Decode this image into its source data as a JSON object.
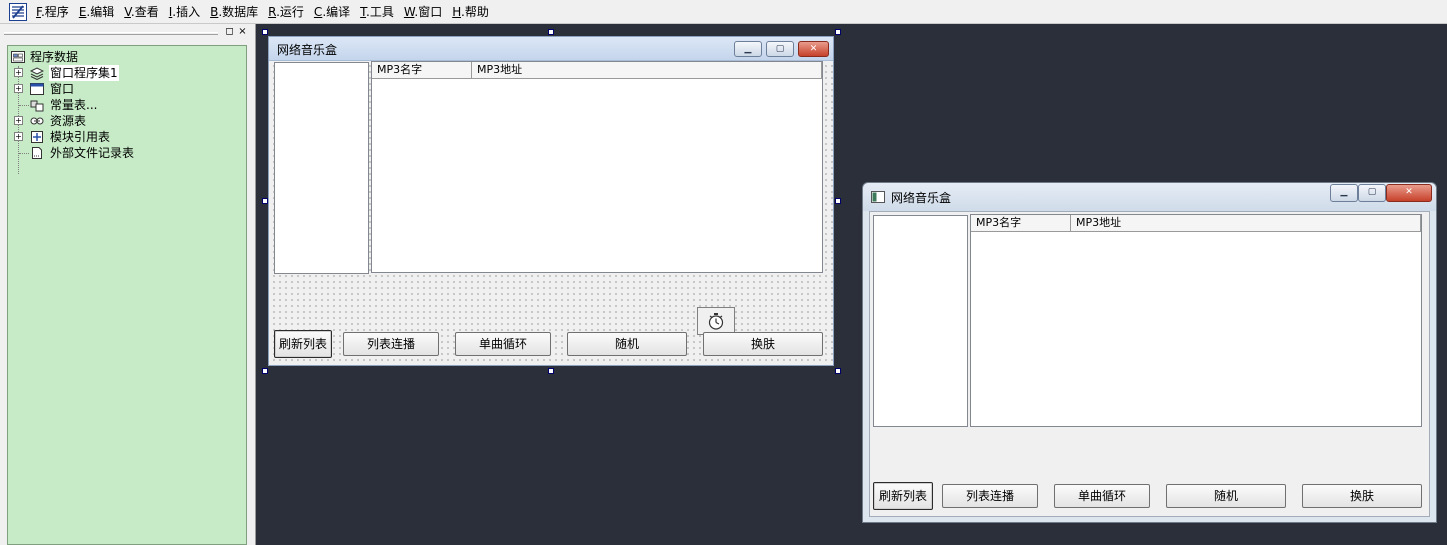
{
  "menu": [
    {
      "key": "F",
      "label": ".程序"
    },
    {
      "key": "E",
      "label": ".编辑"
    },
    {
      "key": "V",
      "label": ".查看"
    },
    {
      "key": "I",
      "label": ".插入"
    },
    {
      "key": "B",
      "label": ".数据库"
    },
    {
      "key": "R",
      "label": ".运行"
    },
    {
      "key": "C",
      "label": ".编译"
    },
    {
      "key": "T",
      "label": ".工具"
    },
    {
      "key": "W",
      "label": ".窗口"
    },
    {
      "key": "H",
      "label": ".帮助"
    }
  ],
  "panel": {
    "restore_symbol": "◻",
    "close_symbol": "×"
  },
  "tree": {
    "root": "程序数据",
    "items": [
      {
        "label": "窗口程序集1",
        "expandable": true,
        "icon": "layers-icon"
      },
      {
        "label": "窗口",
        "expandable": true,
        "icon": "window-icon"
      },
      {
        "label": "常量表...",
        "expandable": false,
        "icon": "cubes-icon"
      },
      {
        "label": "资源表",
        "expandable": true,
        "icon": "resource-icon"
      },
      {
        "label": "模块引用表",
        "expandable": true,
        "icon": "module-icon"
      },
      {
        "label": "外部文件记录表",
        "expandable": false,
        "icon": "file-icon"
      }
    ]
  },
  "design_window": {
    "title": "网络音乐盒",
    "columns": [
      "MP3名字",
      "MP3地址"
    ],
    "buttons": [
      "刷新列表",
      "列表连播",
      "单曲循环",
      "随机",
      "换肤"
    ]
  },
  "run_window": {
    "title": "网络音乐盒",
    "columns": [
      "MP3名字",
      "MP3地址"
    ],
    "buttons": [
      "刷新列表",
      "列表连播",
      "单曲循环",
      "随机",
      "换肤"
    ]
  },
  "symbols": {
    "minimize": "▁",
    "maximize": "▢",
    "close": "✕",
    "expand": "+"
  }
}
